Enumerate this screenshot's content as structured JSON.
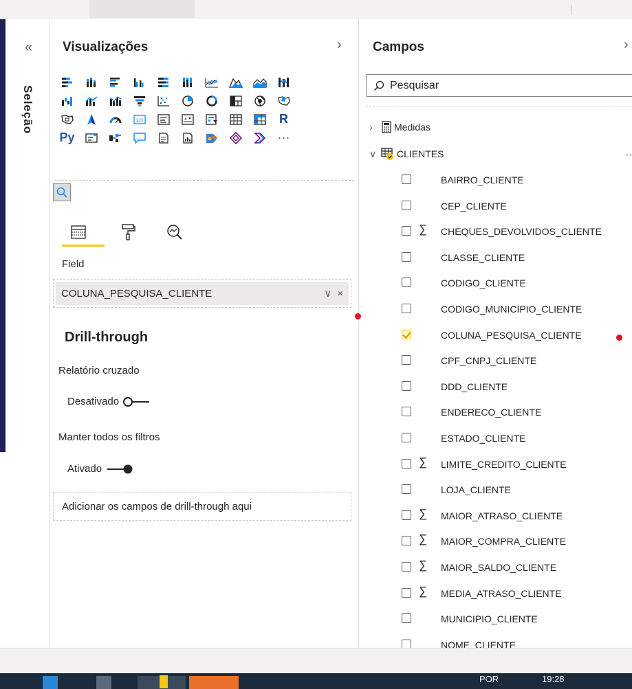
{
  "selection_pane": {
    "collapse_glyph": "«",
    "label": "Seleção"
  },
  "visualizations": {
    "title": "Visualizações",
    "expand_glyph": "›",
    "icon_rows": [
      [
        "stacked-bar-chart",
        "stacked-column-chart",
        "clustered-bar-chart",
        "clustered-column-chart",
        "100-stacked-bar-chart",
        "100-stacked-column-chart",
        "line-chart",
        "area-chart",
        "stacked-area-chart",
        "ribbon-chart"
      ],
      [
        "waterfall-chart",
        "line-and-column-chart",
        "line-and-clustered-column-chart",
        "funnel-chart",
        "scatter-chart",
        "pie-chart",
        "donut-chart",
        "treemap",
        "map",
        "filled-map"
      ],
      [
        "shape-map",
        "azure-map",
        "gauge",
        "card",
        "multi-row-card",
        "kpi",
        "slicer",
        "table",
        "matrix",
        "r-visual"
      ],
      [
        "python-visual",
        "key-influencers",
        "decomposition-tree",
        "qa-visual",
        "smart-narrative",
        "paginated-report",
        "arcgis-map",
        "power-apps",
        "power-automate",
        "more-visuals"
      ]
    ],
    "r_text": "R",
    "py_text": "Py",
    "more_text": "···",
    "field_label": "Field",
    "field_value": "COLUNA_PESQUISA_CLIENTE",
    "field_chevron": "∨",
    "field_remove": "×",
    "drill_title": "Drill-through",
    "cross_report_label": "Relatório cruzado",
    "cross_report_state": "Desativado",
    "keep_filters_label": "Manter todos os filtros",
    "keep_filters_state": "Ativado",
    "drill_placeholder": "Adicionar os campos de drill-through aqui",
    "accent_color": "#f2c811"
  },
  "fields": {
    "title": "Campos",
    "close_glyph": "›",
    "search_placeholder": "Pesquisar",
    "tables": [
      {
        "name": "Medidas",
        "expanded": false
      },
      {
        "name": "CLIENTES",
        "expanded": true
      }
    ],
    "more_glyph": "···",
    "items": [
      {
        "name": "BAIRRO_CLIENTE",
        "sigma": "",
        "checked": false
      },
      {
        "name": "CEP_CLIENTE",
        "sigma": "",
        "checked": false
      },
      {
        "name": "CHEQUES_DEVOLVIDOS_CLIENTE",
        "sigma": "∑",
        "checked": false
      },
      {
        "name": "CLASSE_CLIENTE",
        "sigma": "",
        "checked": false
      },
      {
        "name": "CODIGO_CLIENTE",
        "sigma": "",
        "checked": false
      },
      {
        "name": "CODIGO_MUNICIPIO_CLIENTE",
        "sigma": "",
        "checked": false
      },
      {
        "name": "COLUNA_PESQUISA_CLIENTE",
        "sigma": "",
        "checked": true
      },
      {
        "name": "CPF_CNPJ_CLIENTE",
        "sigma": "",
        "checked": false
      },
      {
        "name": "DDD_CLIENTE",
        "sigma": "",
        "checked": false
      },
      {
        "name": "ENDERECO_CLIENTE",
        "sigma": "",
        "checked": false
      },
      {
        "name": "ESTADO_CLIENTE",
        "sigma": "",
        "checked": false
      },
      {
        "name": "LIMITE_CREDITO_CLIENTE",
        "sigma": "∑",
        "checked": false
      },
      {
        "name": "LOJA_CLIENTE",
        "sigma": "",
        "checked": false
      },
      {
        "name": "MAIOR_ATRASO_CLIENTE",
        "sigma": "∑",
        "checked": false
      },
      {
        "name": "MAIOR_COMPRA_CLIENTE",
        "sigma": "∑",
        "checked": false
      },
      {
        "name": "MAIOR_SALDO_CLIENTE",
        "sigma": "∑",
        "checked": false
      },
      {
        "name": "MEDIA_ATRASO_CLIENTE",
        "sigma": "∑",
        "checked": false
      },
      {
        "name": "MUNICIPIO_CLIENTE",
        "sigma": "",
        "checked": false
      },
      {
        "name": "NOME_CLIENTE",
        "sigma": "",
        "checked": false
      }
    ]
  },
  "taskbar": {
    "language": "POR",
    "time": "19:28"
  },
  "colors": {
    "accent_yellow": "#f2c811",
    "left_accent": "#1f1f5c",
    "marker_red": "#e81123",
    "taskbar": "#1b2b3c"
  }
}
